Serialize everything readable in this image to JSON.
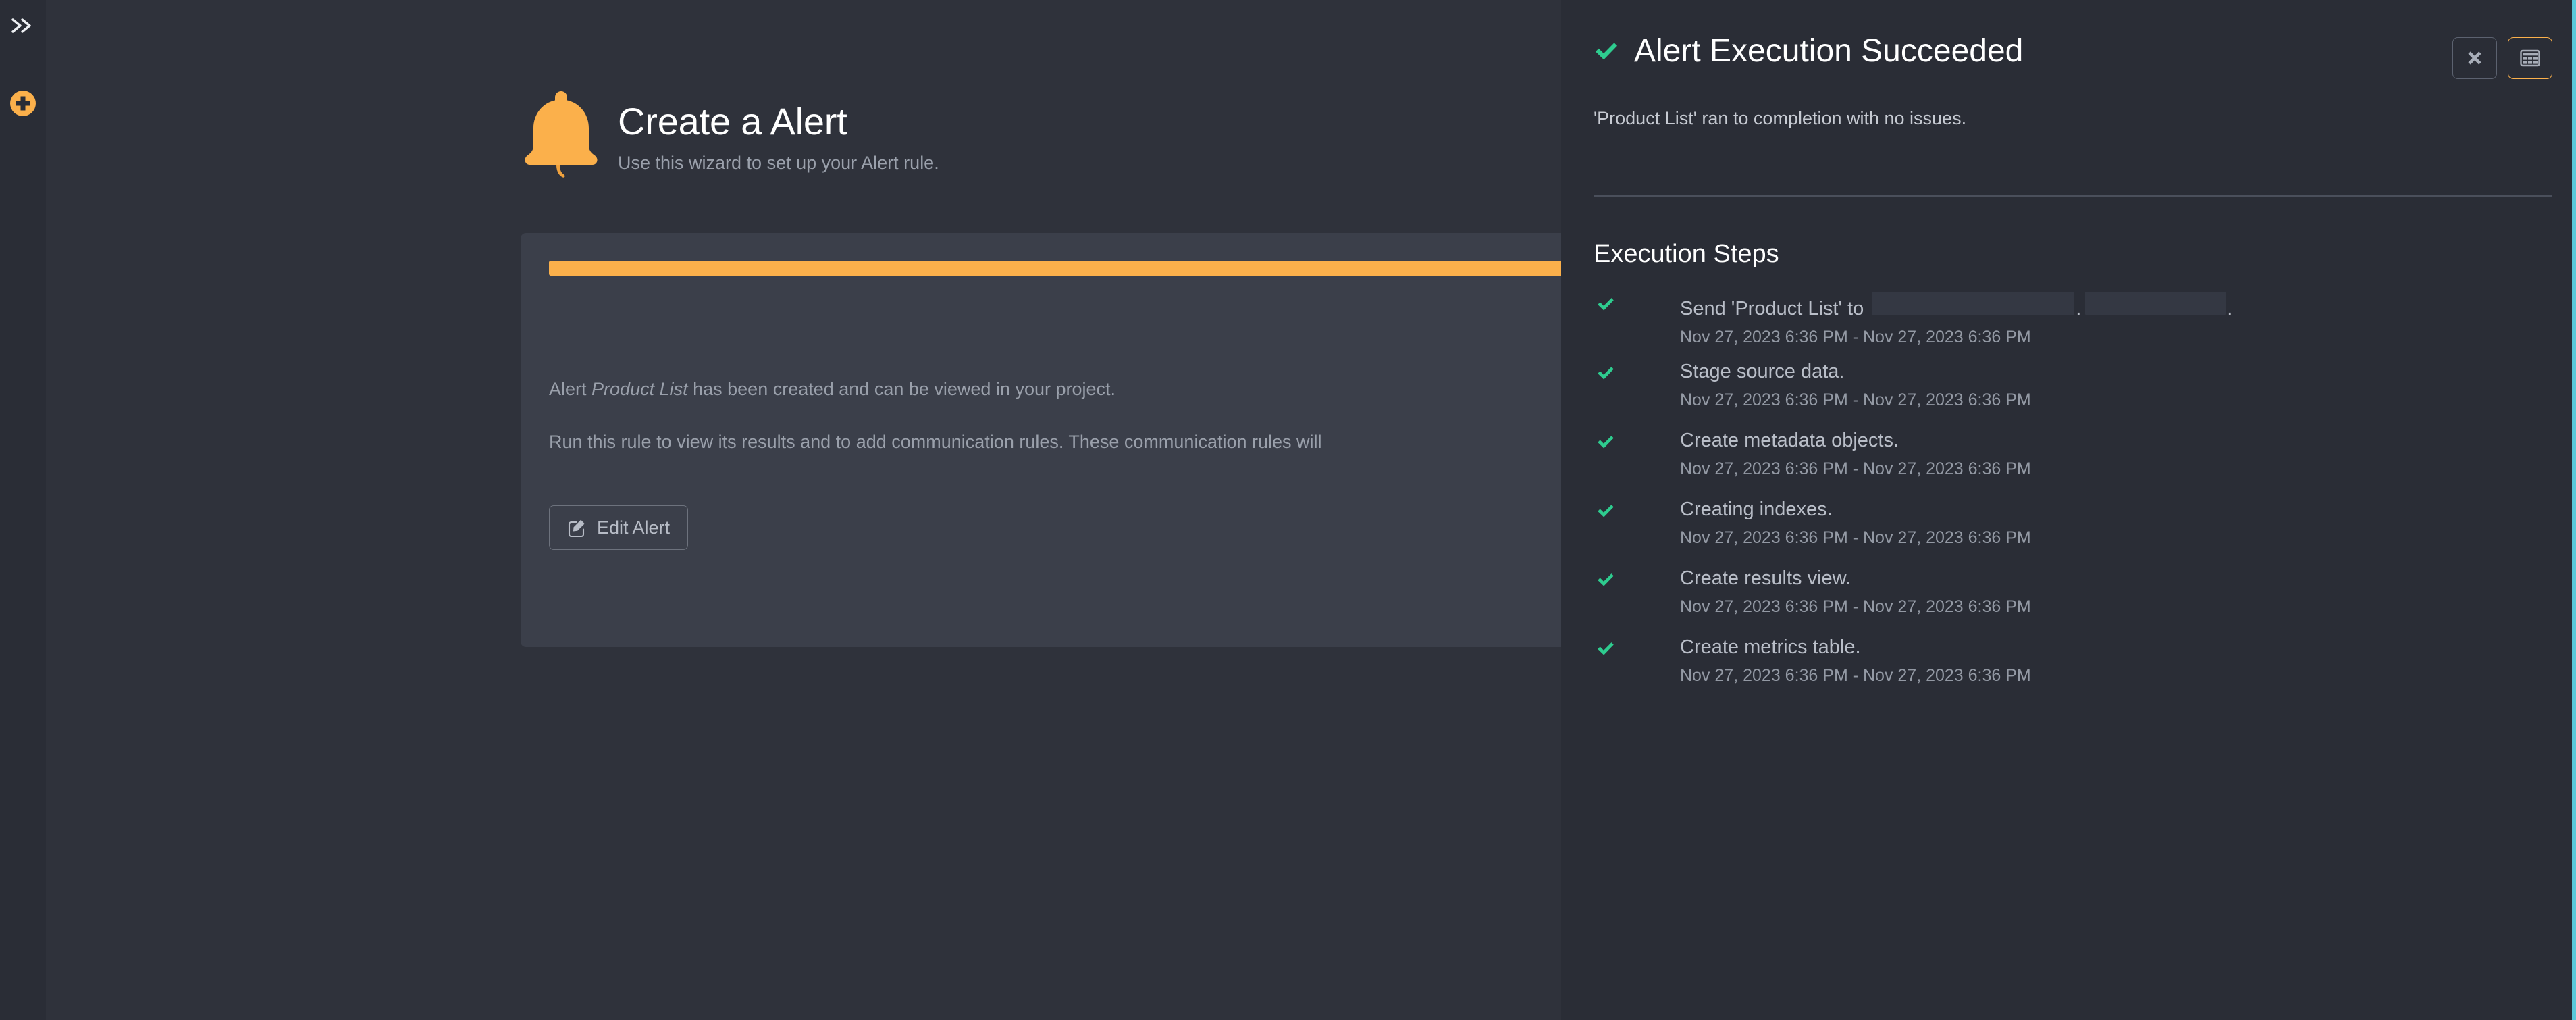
{
  "rail": {
    "expand_icon": "chevron-double-right-icon",
    "add_icon": "plus-circle-icon"
  },
  "wizard": {
    "icon": "bell-icon",
    "title": "Create a Alert",
    "subtitle": "Use this wizard to set up your Alert rule.",
    "progress": {
      "percent": 100,
      "color": "#fbb04b"
    },
    "body": {
      "line1_prefix": "Alert ",
      "line1_emphasis": "Product List",
      "line1_suffix": " has been created and can be viewed in your project.",
      "line2": "Run this rule to view its results and to add communication rules. These communication rules will"
    },
    "edit_button": {
      "label": "Edit Alert",
      "icon": "pencil-square-icon"
    }
  },
  "panel": {
    "accent_color": "#5bc8d8",
    "status_icon": "check-icon",
    "status_color": "#2ecc8f",
    "title": "Alert Execution Succeeded",
    "subtitle": "'Product List' ran to completion with no issues.",
    "actions": [
      {
        "name": "close-button",
        "icon": "close-icon",
        "label": "✖",
        "active": false
      },
      {
        "name": "table-view-button",
        "icon": "table-icon",
        "label": "",
        "active": true
      }
    ],
    "steps_heading": "Execution Steps",
    "steps": [
      {
        "icon": "check-icon",
        "label": "Send 'Product List' to",
        "redacted": true,
        "trailing": ".",
        "time": "Nov 27, 2023 6:36 PM - Nov 27, 2023 6:36 PM"
      },
      {
        "icon": "check-icon",
        "label": "Stage source data.",
        "redacted": false,
        "trailing": "",
        "time": "Nov 27, 2023 6:36 PM - Nov 27, 2023 6:36 PM"
      },
      {
        "icon": "check-icon",
        "label": "Create metadata objects.",
        "redacted": false,
        "trailing": "",
        "time": "Nov 27, 2023 6:36 PM - Nov 27, 2023 6:36 PM"
      },
      {
        "icon": "check-icon",
        "label": "Creating indexes.",
        "redacted": false,
        "trailing": "",
        "time": "Nov 27, 2023 6:36 PM - Nov 27, 2023 6:36 PM"
      },
      {
        "icon": "check-icon",
        "label": "Create results view.",
        "redacted": false,
        "trailing": "",
        "time": "Nov 27, 2023 6:36 PM - Nov 27, 2023 6:36 PM"
      },
      {
        "icon": "check-icon",
        "label": "Create metrics table.",
        "redacted": false,
        "trailing": "",
        "time": "Nov 27, 2023 6:36 PM - Nov 27, 2023 6:36 PM"
      }
    ]
  }
}
